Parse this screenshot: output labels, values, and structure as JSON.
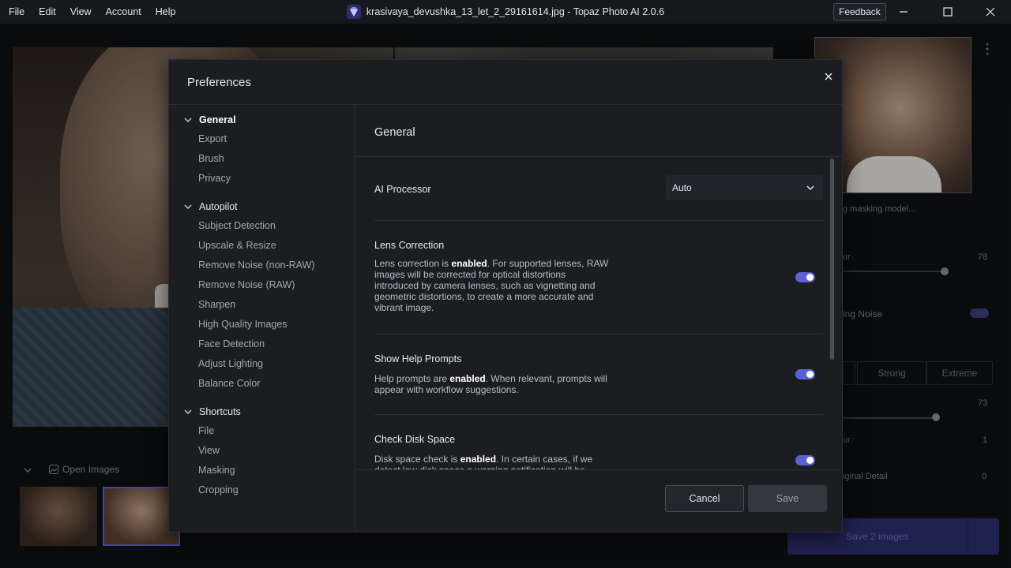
{
  "menu": [
    "File",
    "Edit",
    "View",
    "Account",
    "Help"
  ],
  "window": {
    "title": "krasivaya_devushka_13_let_2_29161614.jpg - Topaz Photo AI 2.0.6",
    "feedback_label": "Feedback"
  },
  "background": {
    "masking_text": "g masking model...",
    "slider1_label": "ur",
    "slider1_value": "78",
    "noise_label": "ing Noise",
    "seg_strong": "Strong",
    "seg_extreme": "Extreme",
    "slider2_value": "73",
    "slider3_label": "ur",
    "slider3_value": "1",
    "detail_label": "iginal Detail",
    "detail_value": "0",
    "save_images_label": "Save 2 images",
    "open_images_label": "Open Images"
  },
  "dialog": {
    "title": "Preferences",
    "nav": {
      "general": {
        "label": "General",
        "items": [
          "Export",
          "Brush",
          "Privacy"
        ]
      },
      "autopilot": {
        "label": "Autopilot",
        "items": [
          "Subject Detection",
          "Upscale & Resize",
          "Remove Noise (non-RAW)",
          "Remove Noise (RAW)",
          "Sharpen",
          "High Quality Images",
          "Face Detection",
          "Adjust Lighting",
          "Balance Color"
        ]
      },
      "shortcuts": {
        "label": "Shortcuts",
        "items": [
          "File",
          "View",
          "Masking",
          "Cropping"
        ]
      }
    },
    "content": {
      "title": "General",
      "ai_processor": {
        "label": "AI Processor",
        "value": "Auto"
      },
      "lens_correction": {
        "label": "Lens Correction",
        "desc_pre": "Lens correction is ",
        "desc_bold": "enabled",
        "desc_post": ". For supported lenses, RAW images will be corrected for optical distortions introduced by camera lenses, such as vignetting and geometric distortions, to create a more accurate and vibrant image.",
        "enabled": true
      },
      "help_prompts": {
        "label": "Show Help Prompts",
        "desc_pre": "Help prompts are ",
        "desc_bold": "enabled",
        "desc_post": ". When relevant, prompts will appear with workflow suggestions.",
        "enabled": true
      },
      "disk_space": {
        "label": "Check Disk Space",
        "desc_pre": "Disk space check is ",
        "desc_bold": "enabled",
        "desc_post": ". In certain cases, if we detect low disk space a warning notification will be",
        "enabled": true
      }
    },
    "buttons": {
      "cancel": "Cancel",
      "save": "Save"
    }
  },
  "colors": {
    "accent": "#5b61d6",
    "dialog_bg": "#1b1d21",
    "titlebar_bg": "#16181c"
  }
}
